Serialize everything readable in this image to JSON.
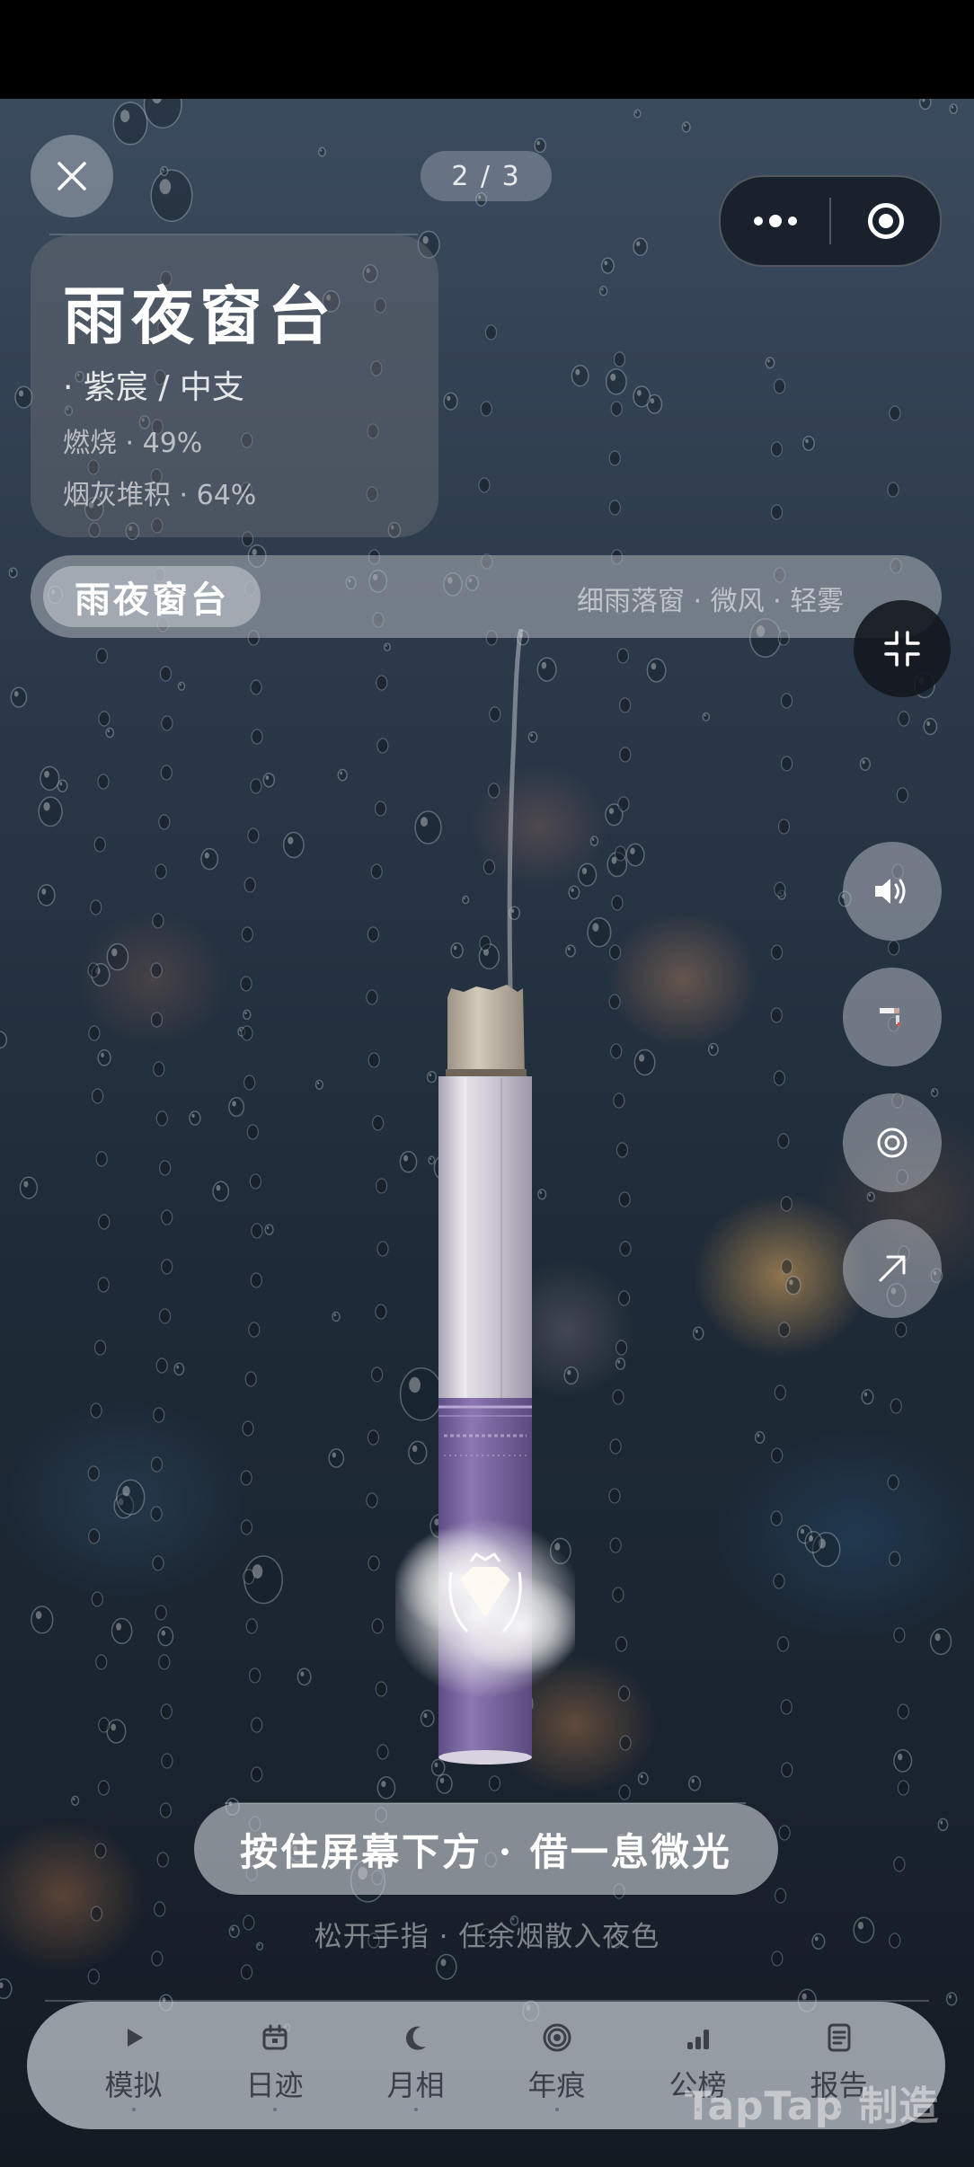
{
  "top_bar": {
    "page_indicator": "2 / 3"
  },
  "info_card": {
    "title": "雨夜窗台",
    "brand_line": "· 紫宸  /  中支",
    "burn_line": "燃烧  ·  49%",
    "ash_line": "烟灰堆积  ·  64%"
  },
  "scene_bar": {
    "chip": "雨夜窗台",
    "tags": "细雨落窗  ·  微风  ·  轻雾"
  },
  "side_actions": [
    {
      "icon": "speaker-icon"
    },
    {
      "icon": "cigarette-icon"
    },
    {
      "icon": "target-icon"
    },
    {
      "icon": "arrow-up-right-icon"
    }
  ],
  "cigarette": {
    "burn_progress": 0.49,
    "ash_accumulation": 0.64,
    "band_color": "#7d67a3",
    "paper_color": "#d9d6de"
  },
  "hint": {
    "main": "按住屏幕下方 · 借一息微光",
    "sub": "松开手指  ·  任余烟散入夜色"
  },
  "bottom_nav": {
    "items": [
      {
        "label": "模拟",
        "icon": "play-icon"
      },
      {
        "label": "日迹",
        "icon": "calendar-icon"
      },
      {
        "label": "月相",
        "icon": "moon-icon"
      },
      {
        "label": "年痕",
        "icon": "spiral-icon"
      },
      {
        "label": "公榜",
        "icon": "bars-icon"
      },
      {
        "label": "报告",
        "icon": "report-icon"
      }
    ]
  },
  "watermark": "TapTap 制造",
  "colors": {
    "background_top": "#3b4b5e",
    "background_bottom": "#131a22",
    "nav_text": "#3a3f48"
  }
}
